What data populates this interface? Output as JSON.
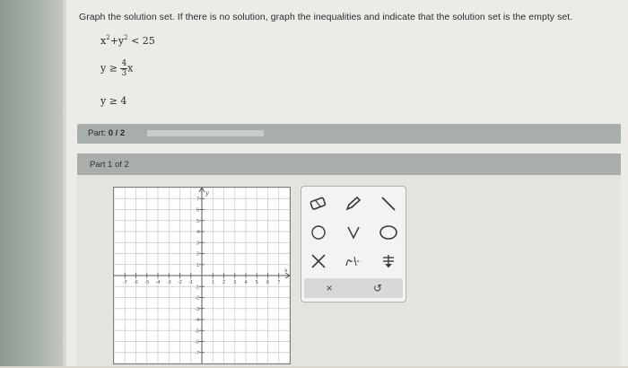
{
  "question": {
    "instruction": "Graph the solution set. If there is no solution, graph the inequalities and indicate that the solution set is the empty set.",
    "eq1": {
      "x": "x",
      "plus": "+y",
      "rel": " < 25",
      "exp": "2"
    },
    "eq2": {
      "lhs": "y ≥ ",
      "num": "4",
      "den": "3",
      "var": "x"
    },
    "eq3": {
      "text": "y ≥ 4"
    }
  },
  "part_bar": {
    "label_prefix": "Part:",
    "progress_text": "0 / 2",
    "progress_fraction": 0.0
  },
  "part1_bar": {
    "label": "Part 1 of 2"
  },
  "graph": {
    "x_label": "x",
    "y_label": "y",
    "x_ticks": [
      "-7",
      "-6",
      "-5",
      "-4",
      "-3",
      "-2",
      "-1",
      "1",
      "2",
      "3",
      "4",
      "5",
      "6",
      "7"
    ],
    "y_ticks": [
      "7",
      "6",
      "5",
      "4",
      "3",
      "2",
      "1",
      "-1",
      "-2",
      "-3",
      "-4",
      "-5",
      "-6",
      "-7"
    ],
    "range": [
      -7,
      7
    ]
  },
  "toolbox": {
    "tools": [
      {
        "name": "eraser-icon"
      },
      {
        "name": "pencil-icon"
      },
      {
        "name": "line-icon"
      },
      {
        "name": "open-circle-icon"
      },
      {
        "name": "union-icon"
      },
      {
        "name": "circle-icon"
      },
      {
        "name": "intersection-x-icon"
      },
      {
        "name": "graph-hatch-icon"
      },
      {
        "name": "shade-icon"
      }
    ],
    "clear_label": "×",
    "undo_label": "↺"
  }
}
